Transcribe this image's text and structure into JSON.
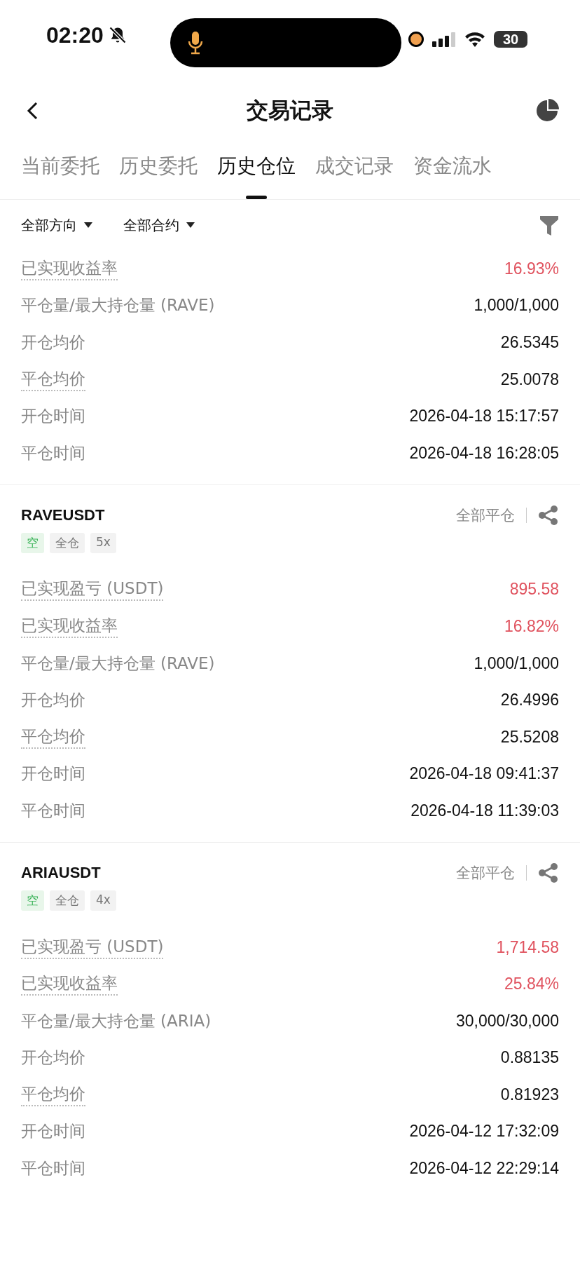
{
  "status_bar": {
    "time": "02:20",
    "battery": "30"
  },
  "header": {
    "title": "交易记录"
  },
  "tabs": [
    {
      "label": "当前委托",
      "selected": false
    },
    {
      "label": "历史委托",
      "selected": false
    },
    {
      "label": "历史仓位",
      "selected": true
    },
    {
      "label": "成交记录",
      "selected": false
    },
    {
      "label": "资金流水",
      "selected": false
    }
  ],
  "filters": [
    {
      "label": "全部方向"
    },
    {
      "label": "全部合约"
    }
  ],
  "positions": [
    {
      "rows": [
        {
          "label": "已实现收益率",
          "value": "16.93%",
          "dotted": true,
          "profit": true
        },
        {
          "label": "平仓量/最大持仓量 (RAVE)",
          "value": "1,000/1,000",
          "dotted": false,
          "profit": false
        },
        {
          "label": "开仓均价",
          "value": "26.5345",
          "dotted": false,
          "profit": false
        },
        {
          "label": "平仓均价",
          "value": "25.0078",
          "dotted": true,
          "profit": false
        },
        {
          "label": "开仓时间",
          "value": "2026-04-18 15:17:57",
          "dotted": false,
          "profit": false
        },
        {
          "label": "平仓时间",
          "value": "2026-04-18 16:28:05",
          "dotted": false,
          "profit": false
        }
      ]
    },
    {
      "symbol": "RAVEUSDT",
      "action": "全部平仓",
      "tags": [
        {
          "label": "空",
          "kind": "side"
        },
        {
          "label": "全仓",
          "kind": "plain"
        },
        {
          "label": "5x",
          "kind": "plain"
        }
      ],
      "rows": [
        {
          "label": "已实现盈亏 (USDT)",
          "value": "895.58",
          "dotted": true,
          "profit": true
        },
        {
          "label": "已实现收益率",
          "value": "16.82%",
          "dotted": true,
          "profit": true
        },
        {
          "label": "平仓量/最大持仓量 (RAVE)",
          "value": "1,000/1,000",
          "dotted": false,
          "profit": false
        },
        {
          "label": "开仓均价",
          "value": "26.4996",
          "dotted": false,
          "profit": false
        },
        {
          "label": "平仓均价",
          "value": "25.5208",
          "dotted": true,
          "profit": false
        },
        {
          "label": "开仓时间",
          "value": "2026-04-18 09:41:37",
          "dotted": false,
          "profit": false
        },
        {
          "label": "平仓时间",
          "value": "2026-04-18 11:39:03",
          "dotted": false,
          "profit": false
        }
      ]
    },
    {
      "symbol": "ARIAUSDT",
      "action": "全部平仓",
      "tags": [
        {
          "label": "空",
          "kind": "side"
        },
        {
          "label": "全仓",
          "kind": "plain"
        },
        {
          "label": "4x",
          "kind": "plain"
        }
      ],
      "rows": [
        {
          "label": "已实现盈亏 (USDT)",
          "value": "1,714.58",
          "dotted": true,
          "profit": true
        },
        {
          "label": "已实现收益率",
          "value": "25.84%",
          "dotted": true,
          "profit": true
        },
        {
          "label": "平仓量/最大持仓量 (ARIA)",
          "value": "30,000/30,000",
          "dotted": false,
          "profit": false
        },
        {
          "label": "开仓均价",
          "value": "0.88135",
          "dotted": false,
          "profit": false
        },
        {
          "label": "平仓均价",
          "value": "0.81923",
          "dotted": true,
          "profit": false
        },
        {
          "label": "开仓时间",
          "value": "2026-04-12 17:32:09",
          "dotted": false,
          "profit": false
        },
        {
          "label": "平仓时间",
          "value": "2026-04-12 22:29:14",
          "dotted": false,
          "profit": false
        }
      ]
    }
  ]
}
